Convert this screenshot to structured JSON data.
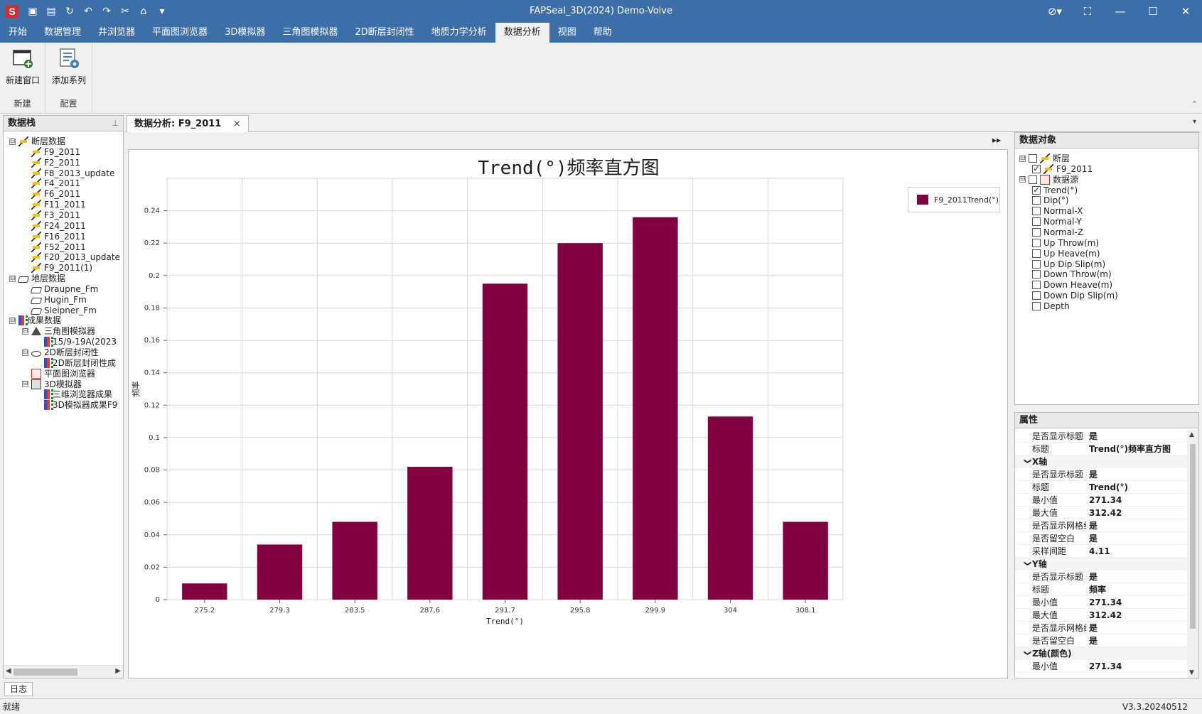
{
  "titlebar": {
    "title": "FAPSeal_3D(2024) Demo-Volve",
    "logo": "S",
    "quick_access": [
      "save-icon",
      "save-all-icon",
      "refresh-icon",
      "undo-icon",
      "redo-icon",
      "cut-icon",
      "home-icon",
      "dropdown-icon"
    ],
    "window_controls": [
      "theme-icon",
      "restore-layout-icon",
      "minimize-icon",
      "maximize-icon",
      "close-icon"
    ]
  },
  "menu": {
    "tabs": [
      "开始",
      "数据管理",
      "井浏览器",
      "平面图浏览器",
      "3D模拟器",
      "三角图模拟器",
      "2D断层封闭性",
      "地质力学分析",
      "数据分析",
      "视图",
      "帮助"
    ],
    "active": "数据分析"
  },
  "ribbon": {
    "groups": [
      {
        "label": "新建",
        "button": "新建窗口"
      },
      {
        "label": "配置",
        "button": "添加系列"
      }
    ]
  },
  "left_panel": {
    "title": "数据栈",
    "pin": "📌",
    "tree": [
      {
        "label": "断层数据",
        "level": 0,
        "icon": "fault-icon",
        "expander": "⊟"
      },
      {
        "label": "F9_2011",
        "level": 1,
        "icon": "fault-icon"
      },
      {
        "label": "F2_2011",
        "level": 1,
        "icon": "fault-icon"
      },
      {
        "label": "F8_2013_update",
        "level": 1,
        "icon": "fault-icon"
      },
      {
        "label": "F4_2011",
        "level": 1,
        "icon": "fault-icon"
      },
      {
        "label": "F6_2011",
        "level": 1,
        "icon": "fault-icon"
      },
      {
        "label": "F11_2011",
        "level": 1,
        "icon": "fault-icon"
      },
      {
        "label": "F3_2011",
        "level": 1,
        "icon": "fault-icon"
      },
      {
        "label": "F24_2011",
        "level": 1,
        "icon": "fault-icon"
      },
      {
        "label": "F16_2011",
        "level": 1,
        "icon": "fault-icon"
      },
      {
        "label": "F52_2011",
        "level": 1,
        "icon": "fault-icon"
      },
      {
        "label": "F20_2013_update",
        "level": 1,
        "icon": "fault-icon"
      },
      {
        "label": "F9_2011(1)",
        "level": 1,
        "icon": "fault-icon"
      },
      {
        "label": "地层数据",
        "level": 0,
        "icon": "layer-icon",
        "expander": "⊟"
      },
      {
        "label": "Draupne_Fm",
        "level": 1,
        "icon": "layer-icon"
      },
      {
        "label": "Hugin_Fm",
        "level": 1,
        "icon": "layer-icon"
      },
      {
        "label": "Sleipner_Fm",
        "level": 1,
        "icon": "layer-icon"
      },
      {
        "label": "成果数据",
        "level": 0,
        "icon": "result-icon",
        "expander": "⊟"
      },
      {
        "label": "三角图模拟器",
        "level": 1,
        "icon": "triangle-icon",
        "expander": "⊟"
      },
      {
        "label": "15/9-19A(2023",
        "level": 2,
        "icon": "result-icon"
      },
      {
        "label": "2D断层封闭性",
        "level": 1,
        "icon": "seal-2d-icon",
        "expander": "⊟"
      },
      {
        "label": "2D断层封闭性成",
        "level": 2,
        "icon": "result-icon"
      },
      {
        "label": "平面图浏览器",
        "level": 1,
        "icon": "plan-icon"
      },
      {
        "label": "3D模拟器",
        "level": 1,
        "icon": "simulator-3d-icon",
        "expander": "⊟"
      },
      {
        "label": "三维浏览器成果",
        "level": 2,
        "icon": "result-icon"
      },
      {
        "label": "3D模拟器成果F9",
        "level": 2,
        "icon": "result-icon"
      }
    ]
  },
  "document": {
    "tab_label": "数据分析: F9_2011",
    "close": "×",
    "dropdown": "▾",
    "expand": "▸▸"
  },
  "chart_data": {
    "type": "bar",
    "title": "Trend(°)频率直方图",
    "xlabel": "Trend(°)",
    "ylabel": "频率",
    "categories": [
      "275.2",
      "279.3",
      "283.5",
      "287.6",
      "291.7",
      "295.8",
      "299.9",
      "304",
      "308.1"
    ],
    "series": [
      {
        "name": "F9_2011Trend(°)",
        "values": [
          0.01,
          0.034,
          0.048,
          0.082,
          0.195,
          0.22,
          0.236,
          0.113,
          0.048
        ],
        "color": "#800040"
      }
    ],
    "ylim": [
      0,
      0.26
    ],
    "yticks": [
      "0",
      "0.02",
      "0.04",
      "0.06",
      "0.08",
      "0.1",
      "0.12",
      "0.14",
      "0.16",
      "0.18",
      "0.2",
      "0.22",
      "0.24"
    ],
    "grid": true,
    "legend": "top-right"
  },
  "data_objects": {
    "title": "数据对象",
    "items": [
      {
        "label": "断层",
        "level": 0,
        "checked": false,
        "expander": "⊟",
        "icon": "fault-icon"
      },
      {
        "label": "F9_2011",
        "level": 1,
        "checked": true,
        "icon": "fault-icon"
      },
      {
        "label": "数据源",
        "level": 0,
        "checked": false,
        "expander": "⊟",
        "icon": "table-icon"
      },
      {
        "label": "Trend(°)",
        "level": 1,
        "checked": true
      },
      {
        "label": "Dip(°)",
        "level": 1,
        "checked": false
      },
      {
        "label": "Normal-X",
        "level": 1,
        "checked": false
      },
      {
        "label": "Normal-Y",
        "level": 1,
        "checked": false
      },
      {
        "label": "Normal-Z",
        "level": 1,
        "checked": false
      },
      {
        "label": "Up Throw(m)",
        "level": 1,
        "checked": false
      },
      {
        "label": "Up Heave(m)",
        "level": 1,
        "checked": false
      },
      {
        "label": "Up Dip Slip(m)",
        "level": 1,
        "checked": false
      },
      {
        "label": "Down Throw(m)",
        "level": 1,
        "checked": false
      },
      {
        "label": "Down Heave(m)",
        "level": 1,
        "checked": false
      },
      {
        "label": "Down Dip Slip(m)",
        "level": 1,
        "checked": false
      },
      {
        "label": "Depth",
        "level": 1,
        "checked": false
      }
    ]
  },
  "properties": {
    "title": "属性",
    "rows": [
      {
        "key": "是否显示标题",
        "value": "是"
      },
      {
        "key": "标题",
        "value": "Trend(°)频率直方图"
      },
      {
        "category": "X轴"
      },
      {
        "key": "是否显示标题",
        "value": "是"
      },
      {
        "key": "标题",
        "value": "Trend(°)"
      },
      {
        "key": "最小值",
        "value": "271.34"
      },
      {
        "key": "最大值",
        "value": "312.42"
      },
      {
        "key": "是否显示网格线",
        "value": "是"
      },
      {
        "key": "是否留空白",
        "value": "是"
      },
      {
        "key": "采样间距",
        "value": "4.11"
      },
      {
        "category": "Y轴"
      },
      {
        "key": "是否显示标题",
        "value": "是"
      },
      {
        "key": "标题",
        "value": "频率"
      },
      {
        "key": "最小值",
        "value": "271.34"
      },
      {
        "key": "最大值",
        "value": "312.42"
      },
      {
        "key": "是否显示网格线",
        "value": "是"
      },
      {
        "key": "是否留空白",
        "value": "是"
      },
      {
        "category": "Z轴(颜色)"
      },
      {
        "key": "最小值",
        "value": "271.34"
      }
    ]
  },
  "bottom": {
    "log_tab": "日志",
    "status": "就绪",
    "version": "V3.3.20240512"
  }
}
